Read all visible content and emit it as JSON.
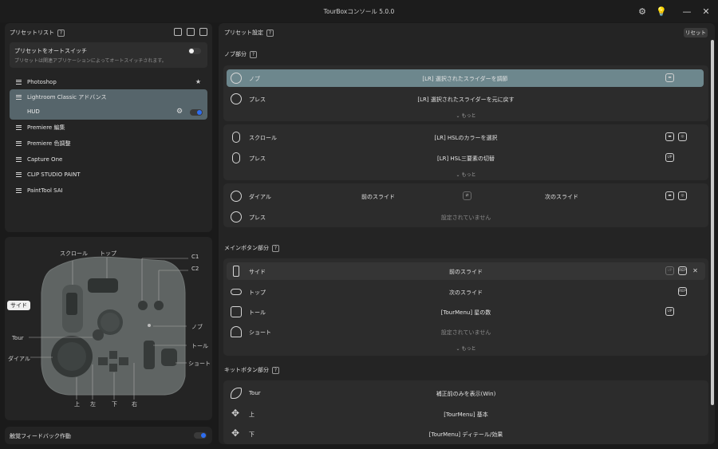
{
  "window": {
    "title": "TourBoxコンソール 5.0.0"
  },
  "left": {
    "header": "プリセットリスト",
    "auto_switch": {
      "title": "プリセットをオートスイッチ",
      "desc": "プリセットは関連アプリケーションによってオートスイッチされます。"
    },
    "presets": [
      {
        "label": "Photoshop",
        "star": "★"
      },
      {
        "label": "Lightroom Classic アドバンス",
        "star": ""
      },
      {
        "label": "Premiere 編集",
        "star": ""
      },
      {
        "label": "Premiere 色調整",
        "star": ""
      },
      {
        "label": "Capture One",
        "star": ""
      },
      {
        "label": "CLIP STUDIO PAINT",
        "star": ""
      },
      {
        "label": "PaintTool SAI",
        "star": ""
      }
    ],
    "hud_label": "HUD",
    "device_labels": {
      "scroll": "スクロール",
      "top": "トップ",
      "c1": "C1",
      "c2": "C2",
      "side": "サイド",
      "knob": "ノブ",
      "tour": "Tour",
      "tall": "トール",
      "dial": "ダイアル",
      "short": "ショート",
      "up": "上",
      "left": "左",
      "down": "下",
      "right": "右"
    },
    "haptic_label": "触覚フィードバック作動"
  },
  "right": {
    "header": "プリセット設定",
    "reset": "リセット",
    "more": "もっと",
    "knob_section": "ノブ部分",
    "knob_rows": [
      {
        "name": "ノブ",
        "action": "[LR] 選択されたスライダーを調節"
      },
      {
        "name": "プレス",
        "action": "[LR] 選択されたスライダーを元に戻す"
      }
    ],
    "scroll_rows": [
      {
        "name": "スクロール",
        "action": "[LR] HSLのカラーを選択"
      },
      {
        "name": "プレス",
        "action": "[LR] HSL三要素の切替"
      }
    ],
    "dial_rows": [
      {
        "name": "ダイアル",
        "left": "前のスライド",
        "right": "次のスライド"
      },
      {
        "name": "プレス",
        "action": "設定されていません"
      }
    ],
    "main_section": "メインボタン部分",
    "main_rows": [
      {
        "name": "サイド",
        "action": "前のスライド"
      },
      {
        "name": "トップ",
        "action": "次のスライド"
      },
      {
        "name": "トール",
        "action": "[TourMenu] 星の数"
      },
      {
        "name": "ショート",
        "action": "設定されていません"
      }
    ],
    "kit_section": "キットボタン部分",
    "kit_rows": [
      {
        "name": "Tour",
        "action": "補正前のみを表示(Win)"
      },
      {
        "name": "上",
        "action": "[TourMenu] 基本"
      },
      {
        "name": "下",
        "action": "[TourMenu] ディテール/効果"
      }
    ]
  }
}
